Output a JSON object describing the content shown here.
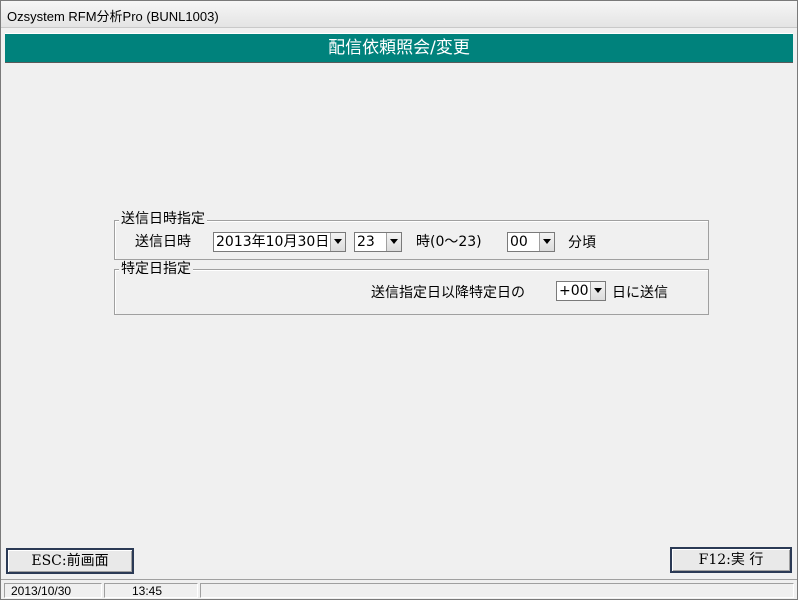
{
  "window": {
    "title": "Ozsystem RFM分析Pro (BUNL1003)"
  },
  "header": {
    "title": "配信依頼照会/変更"
  },
  "send_datetime": {
    "legend": "送信日時指定",
    "label": "送信日時",
    "date_value": "2013年10月30日",
    "hour_value": "23",
    "hour_suffix": "時(0～23)",
    "minute_value": "00",
    "minute_suffix": "分頃"
  },
  "specific_day": {
    "legend": "特定日指定",
    "label": "送信指定日以降特定日の",
    "offset_value": "+00",
    "suffix": "日に送信"
  },
  "buttons": {
    "esc_label": "ESC:前画面",
    "f12_label": "F12:実 行"
  },
  "statusbar": {
    "date": "2013/10/30",
    "time": "13:45"
  }
}
